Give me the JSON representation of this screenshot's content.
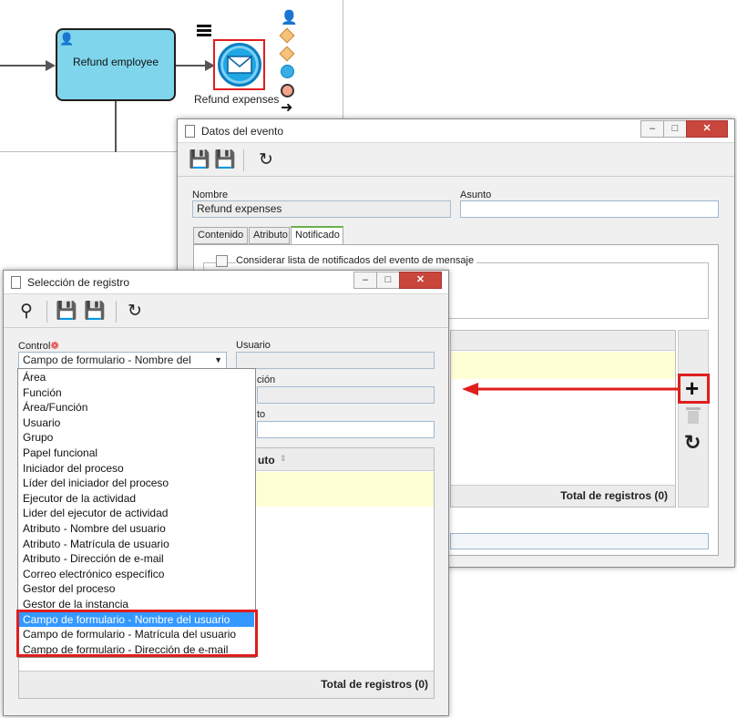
{
  "diagram": {
    "task_label": "Refund employee",
    "event_label": "Refund expenses"
  },
  "event_window": {
    "title": "Datos del evento",
    "nombre_label": "Nombre",
    "nombre_value": "Refund expenses",
    "asunto_label": "Asunto",
    "asunto_value": "",
    "tabs": [
      "Contenido",
      "Atributo",
      "Notificado"
    ],
    "checkbox_label": "Considerar lista de notificados del evento de mensaje",
    "total_label": "Total de registros (0)"
  },
  "record_window": {
    "title": "Selección de registro",
    "control_label": "Control",
    "control_value": "Campo de formulario - Nombre del",
    "usuario_label": "Usuario",
    "funcion_partial_label": "ción",
    "third_partial_label": "to",
    "column_partial_label": "uto",
    "total_label": "Total de registros (0)",
    "options": [
      "Área",
      "Función",
      "Área/Función",
      "Usuario",
      "Grupo",
      "Papel funcional",
      "Iniciador del proceso",
      "Líder del iniciador del proceso",
      "Ejecutor de la actividad",
      "Lider del ejecutor de actividad",
      "Atributo - Nombre del usuario",
      "Atributo - Matrícula de usuario",
      "Atributo - Dirección de e-mail",
      "Correo electrónico específico",
      "Gestor del proceso",
      "Gestor de la instancia",
      "Campo de formulario - Nombre del usuario",
      "Campo de formulario - Matrícula del usuario",
      "Campo de formulario - Dirección de e-mail"
    ]
  },
  "colors": {
    "highlight": "#e01e1e",
    "selection": "#3399ff",
    "grid_row": "#ffffd6",
    "task_fill": "#7fd6ec"
  }
}
